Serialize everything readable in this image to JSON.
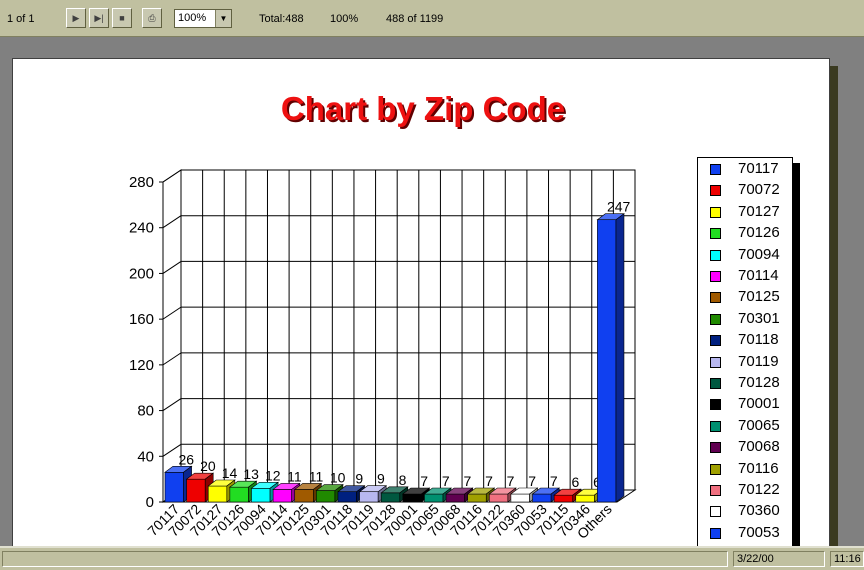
{
  "toolbar": {
    "page_indicator": "1 of 1",
    "zoom_value": "100%",
    "total": "Total:488",
    "percent": "100%",
    "record_count": "488 of 1199"
  },
  "status": {
    "date": "3/22/00",
    "time": "11:16"
  },
  "colors": {
    "title": "#ee1111",
    "bar_default": "#1040f0"
  },
  "chart_data": {
    "type": "bar",
    "title": "Chart by Zip Code",
    "categories": [
      "70117",
      "70072",
      "70127",
      "70126",
      "70094",
      "70114",
      "70125",
      "70301",
      "70118",
      "70119",
      "70128",
      "70001",
      "70065",
      "70068",
      "70116",
      "70122",
      "70360",
      "70053",
      "70115",
      "70346",
      "Others"
    ],
    "values": [
      26,
      20,
      14,
      13,
      12,
      11,
      11,
      10,
      9,
      9,
      8,
      7,
      7,
      7,
      7,
      7,
      7,
      7,
      6,
      6,
      247
    ],
    "value_labels": [
      "26",
      "20",
      "14",
      "13",
      "12",
      "11",
      "11",
      "10",
      "9",
      "9",
      "8",
      "7",
      "7",
      "7",
      "7",
      "7",
      "7",
      "7",
      "6",
      "6",
      "247"
    ],
    "colors": [
      "#1040f0",
      "#ee0000",
      "#ffff00",
      "#22dd22",
      "#00ffff",
      "#ff00ff",
      "#a05a00",
      "#208a00",
      "#002080",
      "#b8b8f0",
      "#005840",
      "#000000",
      "#009070",
      "#600050",
      "#a0a000",
      "#f07080",
      "#ffffff",
      "#1040f0",
      "#ee0000",
      "#ffff00",
      "#1040f0"
    ],
    "yticks": [
      "0",
      "40",
      "80",
      "120",
      "160",
      "200",
      "240",
      "280"
    ],
    "ylim": [
      0,
      280
    ],
    "grid": true,
    "three_d": true,
    "legend_position": "right",
    "legend_entries": [
      "70117",
      "70072",
      "70127",
      "70126",
      "70094",
      "70114",
      "70125",
      "70301",
      "70118",
      "70119",
      "70128",
      "70001",
      "70065",
      "70068",
      "70116",
      "70122",
      "70360",
      "70053"
    ],
    "legend_colors": [
      "#1040f0",
      "#ee0000",
      "#ffff00",
      "#22dd22",
      "#00ffff",
      "#ff00ff",
      "#a05a00",
      "#208a00",
      "#002080",
      "#b8b8f0",
      "#005840",
      "#000000",
      "#009070",
      "#600050",
      "#a0a000",
      "#f07080",
      "#ffffff",
      "#1040f0"
    ]
  }
}
